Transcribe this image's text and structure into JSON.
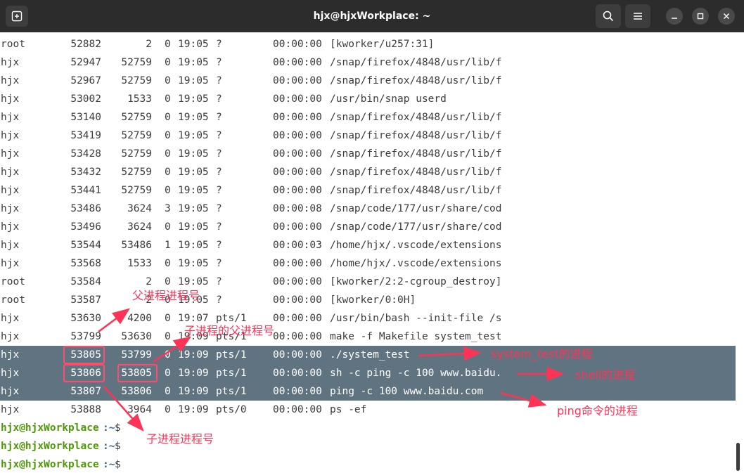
{
  "window": {
    "title": "hjx@hjxWorkplace: ~"
  },
  "toolbar": {
    "new_tab_icon": "new-tab-icon",
    "search_icon": "search-icon",
    "menu_icon": "hamburger-menu-icon",
    "minimize_icon": "minimize-icon",
    "maximize_icon": "maximize-icon",
    "close_icon": "close-icon"
  },
  "processes": [
    {
      "user": "root",
      "pid": "52882",
      "ppid": "2",
      "c": "0",
      "stime": "19:05",
      "tty": "?",
      "time": "00:00:00",
      "cmd": "[kworker/u257:31]"
    },
    {
      "user": "hjx",
      "pid": "52947",
      "ppid": "52759",
      "c": "0",
      "stime": "19:05",
      "tty": "?",
      "time": "00:00:00",
      "cmd": "/snap/firefox/4848/usr/lib/f"
    },
    {
      "user": "hjx",
      "pid": "52967",
      "ppid": "52759",
      "c": "0",
      "stime": "19:05",
      "tty": "?",
      "time": "00:00:00",
      "cmd": "/snap/firefox/4848/usr/lib/f"
    },
    {
      "user": "hjx",
      "pid": "53002",
      "ppid": "1533",
      "c": "0",
      "stime": "19:05",
      "tty": "?",
      "time": "00:00:00",
      "cmd": "/usr/bin/snap userd"
    },
    {
      "user": "hjx",
      "pid": "53140",
      "ppid": "52759",
      "c": "0",
      "stime": "19:05",
      "tty": "?",
      "time": "00:00:00",
      "cmd": "/snap/firefox/4848/usr/lib/f"
    },
    {
      "user": "hjx",
      "pid": "53419",
      "ppid": "52759",
      "c": "0",
      "stime": "19:05",
      "tty": "?",
      "time": "00:00:00",
      "cmd": "/snap/firefox/4848/usr/lib/f"
    },
    {
      "user": "hjx",
      "pid": "53428",
      "ppid": "52759",
      "c": "0",
      "stime": "19:05",
      "tty": "?",
      "time": "00:00:00",
      "cmd": "/snap/firefox/4848/usr/lib/f"
    },
    {
      "user": "hjx",
      "pid": "53432",
      "ppid": "52759",
      "c": "0",
      "stime": "19:05",
      "tty": "?",
      "time": "00:00:00",
      "cmd": "/snap/firefox/4848/usr/lib/f"
    },
    {
      "user": "hjx",
      "pid": "53441",
      "ppid": "52759",
      "c": "0",
      "stime": "19:05",
      "tty": "?",
      "time": "00:00:00",
      "cmd": "/snap/firefox/4848/usr/lib/f"
    },
    {
      "user": "hjx",
      "pid": "53486",
      "ppid": "3624",
      "c": "3",
      "stime": "19:05",
      "tty": "?",
      "time": "00:00:08",
      "cmd": "/snap/code/177/usr/share/cod"
    },
    {
      "user": "hjx",
      "pid": "53496",
      "ppid": "3624",
      "c": "0",
      "stime": "19:05",
      "tty": "?",
      "time": "00:00:00",
      "cmd": "/snap/code/177/usr/share/cod"
    },
    {
      "user": "hjx",
      "pid": "53544",
      "ppid": "53486",
      "c": "1",
      "stime": "19:05",
      "tty": "?",
      "time": "00:00:03",
      "cmd": "/home/hjx/.vscode/extensions"
    },
    {
      "user": "hjx",
      "pid": "53568",
      "ppid": "1533",
      "c": "0",
      "stime": "19:05",
      "tty": "?",
      "time": "00:00:00",
      "cmd": "/home/hjx/.vscode/extensions"
    },
    {
      "user": "root",
      "pid": "53584",
      "ppid": "2",
      "c": "0",
      "stime": "19:05",
      "tty": "?",
      "time": "00:00:00",
      "cmd": "[kworker/2:2-cgroup_destroy]"
    },
    {
      "user": "root",
      "pid": "53587",
      "ppid": "2",
      "c": "0",
      "stime": "19:05",
      "tty": "?",
      "time": "00:00:00",
      "cmd": "[kworker/0:0H]"
    },
    {
      "user": "hjx",
      "pid": "53630",
      "ppid": "4200",
      "c": "0",
      "stime": "19:07",
      "tty": "pts/1",
      "time": "00:00:00",
      "cmd": "/usr/bin/bash --init-file /s"
    },
    {
      "user": "hjx",
      "pid": "53799",
      "ppid": "53630",
      "c": "0",
      "stime": "19:09",
      "tty": "pts/1",
      "time": "00:00:00",
      "cmd": "make -f Makefile system_test"
    },
    {
      "user": "hjx",
      "pid": "53805",
      "ppid": "53799",
      "c": "0",
      "stime": "19:09",
      "tty": "pts/1",
      "time": "00:00:00",
      "cmd": "./system_test",
      "highlight": true
    },
    {
      "user": "hjx",
      "pid": "53806",
      "ppid": "53805",
      "c": "0",
      "stime": "19:09",
      "tty": "pts/1",
      "time": "00:00:00",
      "cmd": "sh -c ping -c 100 www.baidu.",
      "highlight": true
    },
    {
      "user": "hjx",
      "pid": "53807",
      "ppid": "53806",
      "c": "0",
      "stime": "19:09",
      "tty": "pts/1",
      "time": "00:00:00",
      "cmd": "ping -c 100 www.baidu.com",
      "highlight": true
    },
    {
      "user": "hjx",
      "pid": "53888",
      "ppid": "3964",
      "c": "0",
      "stime": "19:09",
      "tty": "pts/0",
      "time": "00:00:00",
      "cmd": "ps -ef"
    }
  ],
  "prompt": {
    "user_host": "hjx@hjxWorkplace",
    "path": ":~",
    "symbol": "$",
    "count": 3
  },
  "annotations": {
    "parent_pid": "父进程进程号",
    "child_parent_pid": "子进程的父进程号",
    "system_test": "system_test的进程",
    "shell": "shell的进程",
    "ping": "ping命令的进程",
    "child_pid": "子进程进程号",
    "color": "#ff3355"
  }
}
